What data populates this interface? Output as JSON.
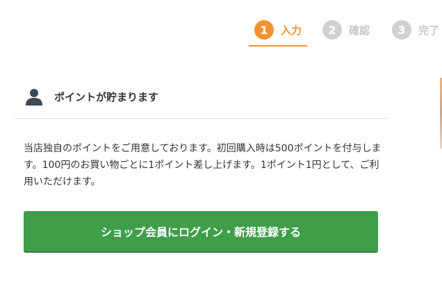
{
  "stepper": {
    "steps": [
      {
        "number": "1",
        "label": "入力",
        "state": "active"
      },
      {
        "number": "2",
        "label": "確認",
        "state": "inactive"
      },
      {
        "number": "3",
        "label": "完了",
        "state": "inactive"
      }
    ]
  },
  "points": {
    "icon": "person-icon",
    "title": "ポイントが貯まります",
    "description": "当店独自のポイントをご用意しております。初回購入時は500ポイントを付与します。100円のお買い物ごとに1ポイント差し上げます。1ポイント1円として、ご利用いただけます。",
    "button_label": "ショップ会員にログイン・新規登録する"
  },
  "colors": {
    "accent": "#f5922f",
    "inactive": "#cdd1d4",
    "button": "#3e9e4a",
    "icon": "#3d4a55"
  }
}
